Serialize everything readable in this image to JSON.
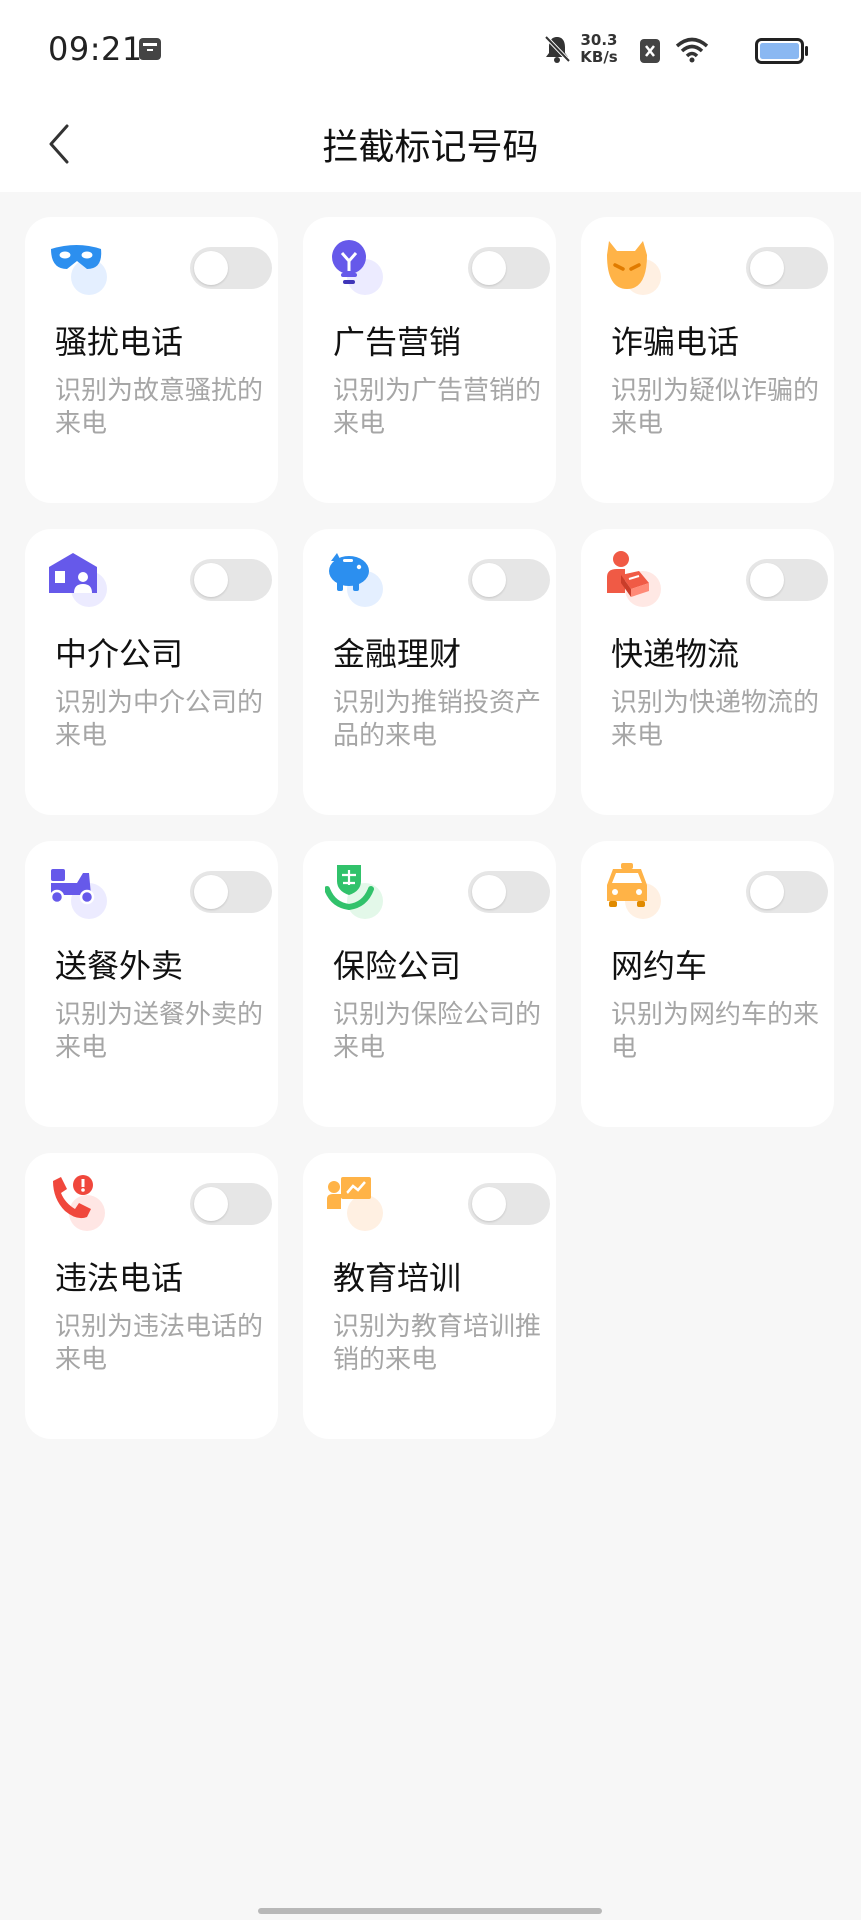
{
  "status_bar": {
    "time": "09:21",
    "net_speed_value": "30.3",
    "net_speed_unit": "KB/s",
    "icons": [
      "app-notification-icon",
      "mute-bell-icon",
      "close-box-icon",
      "wifi-icon",
      "battery-icon"
    ]
  },
  "header": {
    "title": "拦截标记号码",
    "back_icon": "chevron-left-icon"
  },
  "categories": [
    {
      "title": "骚扰电话",
      "desc": "识别为故意骚扰的来电",
      "icon": "mask-icon",
      "enabled": false
    },
    {
      "title": "广告营销",
      "desc": "识别为广告营销的来电",
      "icon": "lightbulb-icon",
      "enabled": false
    },
    {
      "title": "诈骗电话",
      "desc": "识别为疑似诈骗的来电",
      "icon": "devil-icon",
      "enabled": false
    },
    {
      "title": "中介公司",
      "desc": "识别为中介公司的来电",
      "icon": "house-agent-icon",
      "enabled": false
    },
    {
      "title": "金融理财",
      "desc": "识别为推销投资产品的来电",
      "icon": "piggy-bank-icon",
      "enabled": false
    },
    {
      "title": "快递物流",
      "desc": "识别为快递物流的来电",
      "icon": "courier-icon",
      "enabled": false
    },
    {
      "title": "送餐外卖",
      "desc": "识别为送餐外卖的来电",
      "icon": "scooter-icon",
      "enabled": false
    },
    {
      "title": "保险公司",
      "desc": "识别为保险公司的来电",
      "icon": "insurance-shield-icon",
      "enabled": false
    },
    {
      "title": "网约车",
      "desc": "识别为网约车的来电",
      "icon": "taxi-icon",
      "enabled": false
    },
    {
      "title": "违法电话",
      "desc": "识别为违法电话的来电",
      "icon": "phone-alert-icon",
      "enabled": false
    },
    {
      "title": "教育培训",
      "desc": "识别为教育培训推销的来电",
      "icon": "teacher-board-icon",
      "enabled": false
    }
  ],
  "colors": {
    "background": "#f7f7f7",
    "card": "#ffffff",
    "toggle_off": "#e6e6e6",
    "desc_text": "#a6a6a6"
  }
}
